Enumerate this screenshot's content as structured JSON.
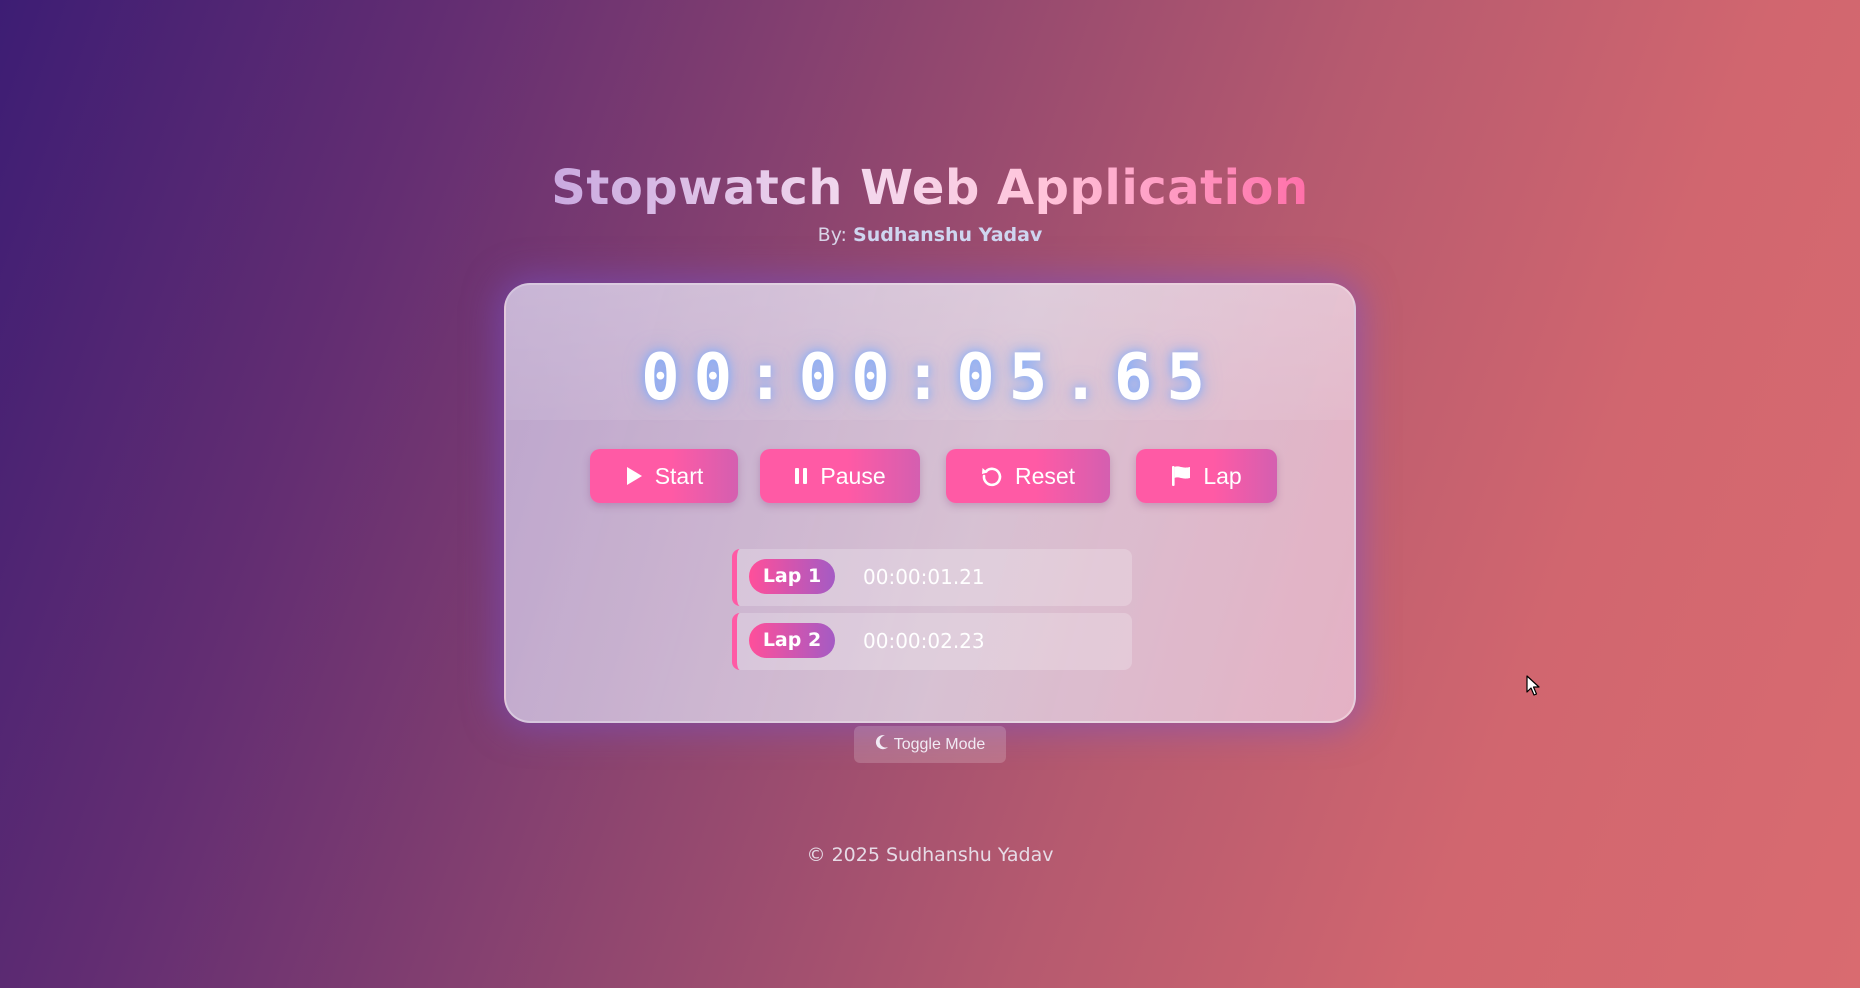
{
  "header": {
    "title": "Stopwatch Web Application",
    "by_prefix": "By:",
    "author": "Sudhanshu Yadav"
  },
  "stopwatch": {
    "time": "00:00:05.65"
  },
  "controls": {
    "start_label": "Start",
    "pause_label": "Pause",
    "reset_label": "Reset",
    "lap_label": "Lap",
    "start_icon": "play-icon",
    "pause_icon": "pause-icon",
    "reset_icon": "reset-icon",
    "lap_icon": "flag-icon"
  },
  "laps": [
    {
      "label": "Lap 1",
      "time": "00:00:01.21"
    },
    {
      "label": "Lap 2",
      "time": "00:00:02.23"
    }
  ],
  "toggle": {
    "label": "Toggle Mode",
    "icon": "moon-icon"
  },
  "footer": {
    "text": "© 2025 Sudhanshu Yadav"
  },
  "colors": {
    "accent": "#ff5aa5",
    "accent_end": "#a45bc4",
    "background_start": "#3d1d74",
    "background_end": "#d96b70"
  }
}
